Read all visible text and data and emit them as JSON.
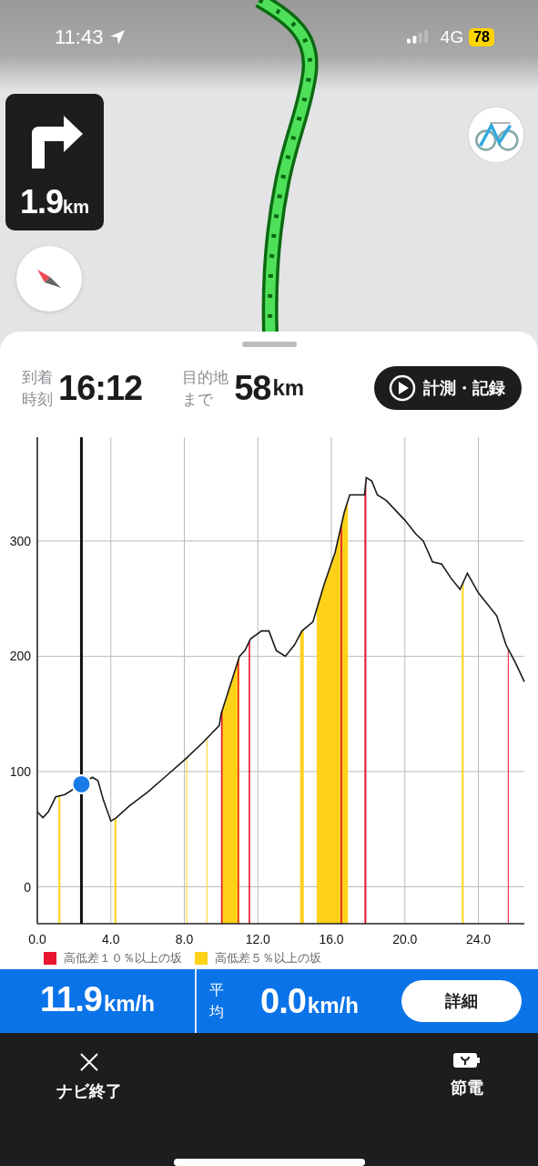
{
  "status_bar": {
    "time": "11:43",
    "network": "4G",
    "battery": "78"
  },
  "turn_card": {
    "distance": "1.9",
    "unit": "km"
  },
  "trip_info": [
    {
      "label_lines": [
        "到着",
        "時刻"
      ],
      "value": "16:12"
    },
    {
      "label_lines": [
        "目的地",
        "まで"
      ],
      "value": "58",
      "unit": "km"
    }
  ],
  "record_button": {
    "label": "計測・記録"
  },
  "elevation_chart": {
    "chart_data": {
      "type": "line",
      "xlim": [
        0,
        26.5
      ],
      "ylim": [
        -32,
        390
      ],
      "xticks": [
        {
          "value": 0,
          "label": "0.0"
        },
        {
          "value": 4,
          "label": "4.0"
        },
        {
          "value": 8,
          "label": "8.0"
        },
        {
          "value": 12,
          "label": "12.0"
        },
        {
          "value": 16,
          "label": "16.0"
        },
        {
          "value": 20,
          "label": "20.0"
        },
        {
          "value": 24,
          "label": "24.0"
        }
      ],
      "yticks": [
        0,
        100,
        200,
        300
      ],
      "grid": true,
      "x": [
        0,
        0.3,
        0.6,
        1.0,
        1.5,
        3.0,
        3.3,
        3.6,
        4.0,
        4.3,
        5,
        6,
        7,
        8,
        9,
        9.9,
        10,
        10.5,
        11,
        11.3,
        11.6,
        12.2,
        12.6,
        13.0,
        13.5,
        14,
        14.4,
        15,
        15.6,
        16.2,
        16.7,
        17.0,
        17.8,
        17.9,
        18.2,
        18.5,
        19,
        20,
        20.6,
        21,
        21.5,
        22,
        22.5,
        23,
        23.4,
        24,
        25,
        25.5,
        26,
        26.5
      ],
      "series": [
        {
          "color": "#1a1a1a",
          "values": [
            65,
            60,
            65,
            78,
            80,
            95,
            92,
            75,
            57,
            60,
            70,
            82,
            96,
            110,
            125,
            140,
            150,
            175,
            200,
            205,
            215,
            222,
            222,
            205,
            200,
            210,
            222,
            230,
            262,
            290,
            325,
            340,
            340,
            355,
            352,
            340,
            335,
            318,
            306,
            300,
            282,
            280,
            268,
            258,
            272,
            255,
            235,
            210,
            195,
            178
          ]
        }
      ],
      "bands": [
        {
          "axis": "x",
          "from": 1.15,
          "to": 1.25,
          "color": "#ffd21a"
        },
        {
          "axis": "x",
          "from": 4.2,
          "to": 4.3,
          "color": "#ffd21a"
        },
        {
          "axis": "x",
          "from": 8.1,
          "to": 8.15,
          "color": "#ffd21a"
        },
        {
          "axis": "x",
          "from": 9.2,
          "to": 9.25,
          "color": "#ffd21a"
        },
        {
          "axis": "x",
          "from": 10.0,
          "to": 11.0,
          "color": "#ffd21a"
        },
        {
          "axis": "x",
          "from": 10.0,
          "to": 10.08,
          "color": "#e8162e"
        },
        {
          "axis": "x",
          "from": 10.9,
          "to": 10.97,
          "color": "#e8162e"
        },
        {
          "axis": "x",
          "from": 11.5,
          "to": 11.58,
          "color": "#e8162e"
        },
        {
          "axis": "x",
          "from": 14.3,
          "to": 14.5,
          "color": "#ffd21a"
        },
        {
          "axis": "x",
          "from": 15.2,
          "to": 16.9,
          "color": "#ffd21a"
        },
        {
          "axis": "x",
          "from": 16.5,
          "to": 16.58,
          "color": "#e8162e"
        },
        {
          "axis": "x",
          "from": 17.8,
          "to": 17.9,
          "color": "#e8162e"
        },
        {
          "axis": "x",
          "from": 23.1,
          "to": 23.2,
          "color": "#ffd21a"
        },
        {
          "axis": "x",
          "from": 25.6,
          "to": 25.65,
          "color": "#e8162e"
        }
      ],
      "ref_lines": [
        {
          "axis": "x",
          "value": 2.4,
          "color": "#111111"
        }
      ]
    },
    "legend": [
      {
        "label": "高低差１０％以上の坂",
        "color": "#e8162e"
      },
      {
        "label": "高低差５％以上の坂",
        "color": "#ffd21a"
      }
    ]
  },
  "speed_bar": {
    "speed": "11.9",
    "unit": "km/h",
    "avg_label": "平均",
    "avg_speed": "0.0",
    "avg_unit": "km/h",
    "details_button": "詳細"
  },
  "bottom_bar": [
    {
      "kind": "close",
      "label": "ナビ終了"
    },
    {
      "kind": "battery",
      "label": "節電"
    }
  ]
}
